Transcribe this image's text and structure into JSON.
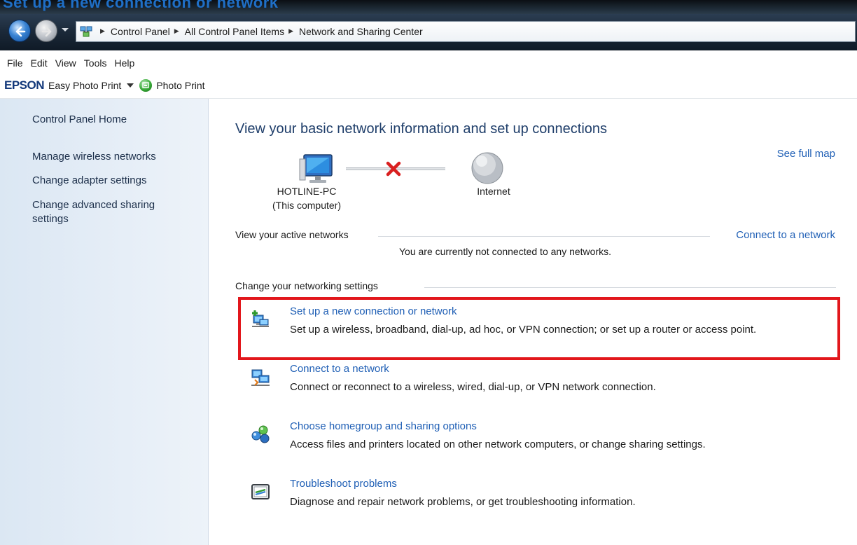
{
  "window": {
    "cut_title": "Set up a new connection or network"
  },
  "address_bar": {
    "breadcrumbs": [
      "Control Panel",
      "All Control Panel Items",
      "Network and Sharing Center"
    ]
  },
  "menu_bar": {
    "items": [
      "File",
      "Edit",
      "View",
      "Tools",
      "Help"
    ]
  },
  "epson_toolbar": {
    "logo": "EPSON",
    "easy_photo_print": "Easy Photo Print",
    "photo_print": "Photo Print"
  },
  "left_pane": {
    "home": "Control Panel Home",
    "links": [
      "Manage wireless networks",
      "Change adapter settings",
      "Change advanced sharing settings"
    ]
  },
  "main": {
    "title": "View your basic network information and set up connections",
    "see_full_map": "See full map",
    "computer_name": "HOTLINE-PC",
    "computer_sub": "(This computer)",
    "internet_label": "Internet",
    "active_networks_header": "View your active networks",
    "connect_to_network_link": "Connect to a network",
    "not_connected_text": "You are currently not connected to any networks.",
    "change_settings_header": "Change your networking settings",
    "tasks": [
      {
        "icon": "new-connection-icon",
        "title": "Set up a new connection or network",
        "description": "Set up a wireless, broadband, dial-up, ad hoc, or VPN connection; or set up a router or access point."
      },
      {
        "icon": "connect-network-icon",
        "title": "Connect to a network",
        "description": "Connect or reconnect to a wireless, wired, dial-up, or VPN network connection."
      },
      {
        "icon": "homegroup-icon",
        "title": "Choose homegroup and sharing options",
        "description": "Access files and printers located on other network computers, or change sharing settings."
      },
      {
        "icon": "troubleshoot-icon",
        "title": "Troubleshoot problems",
        "description": "Diagnose and repair network problems, or get troubleshooting information."
      }
    ]
  },
  "colors": {
    "link_blue": "#1f5fb5",
    "title_blue": "#1f3e6a",
    "highlight_red": "#e2171c",
    "disconnect_red": "#d91f1f"
  }
}
